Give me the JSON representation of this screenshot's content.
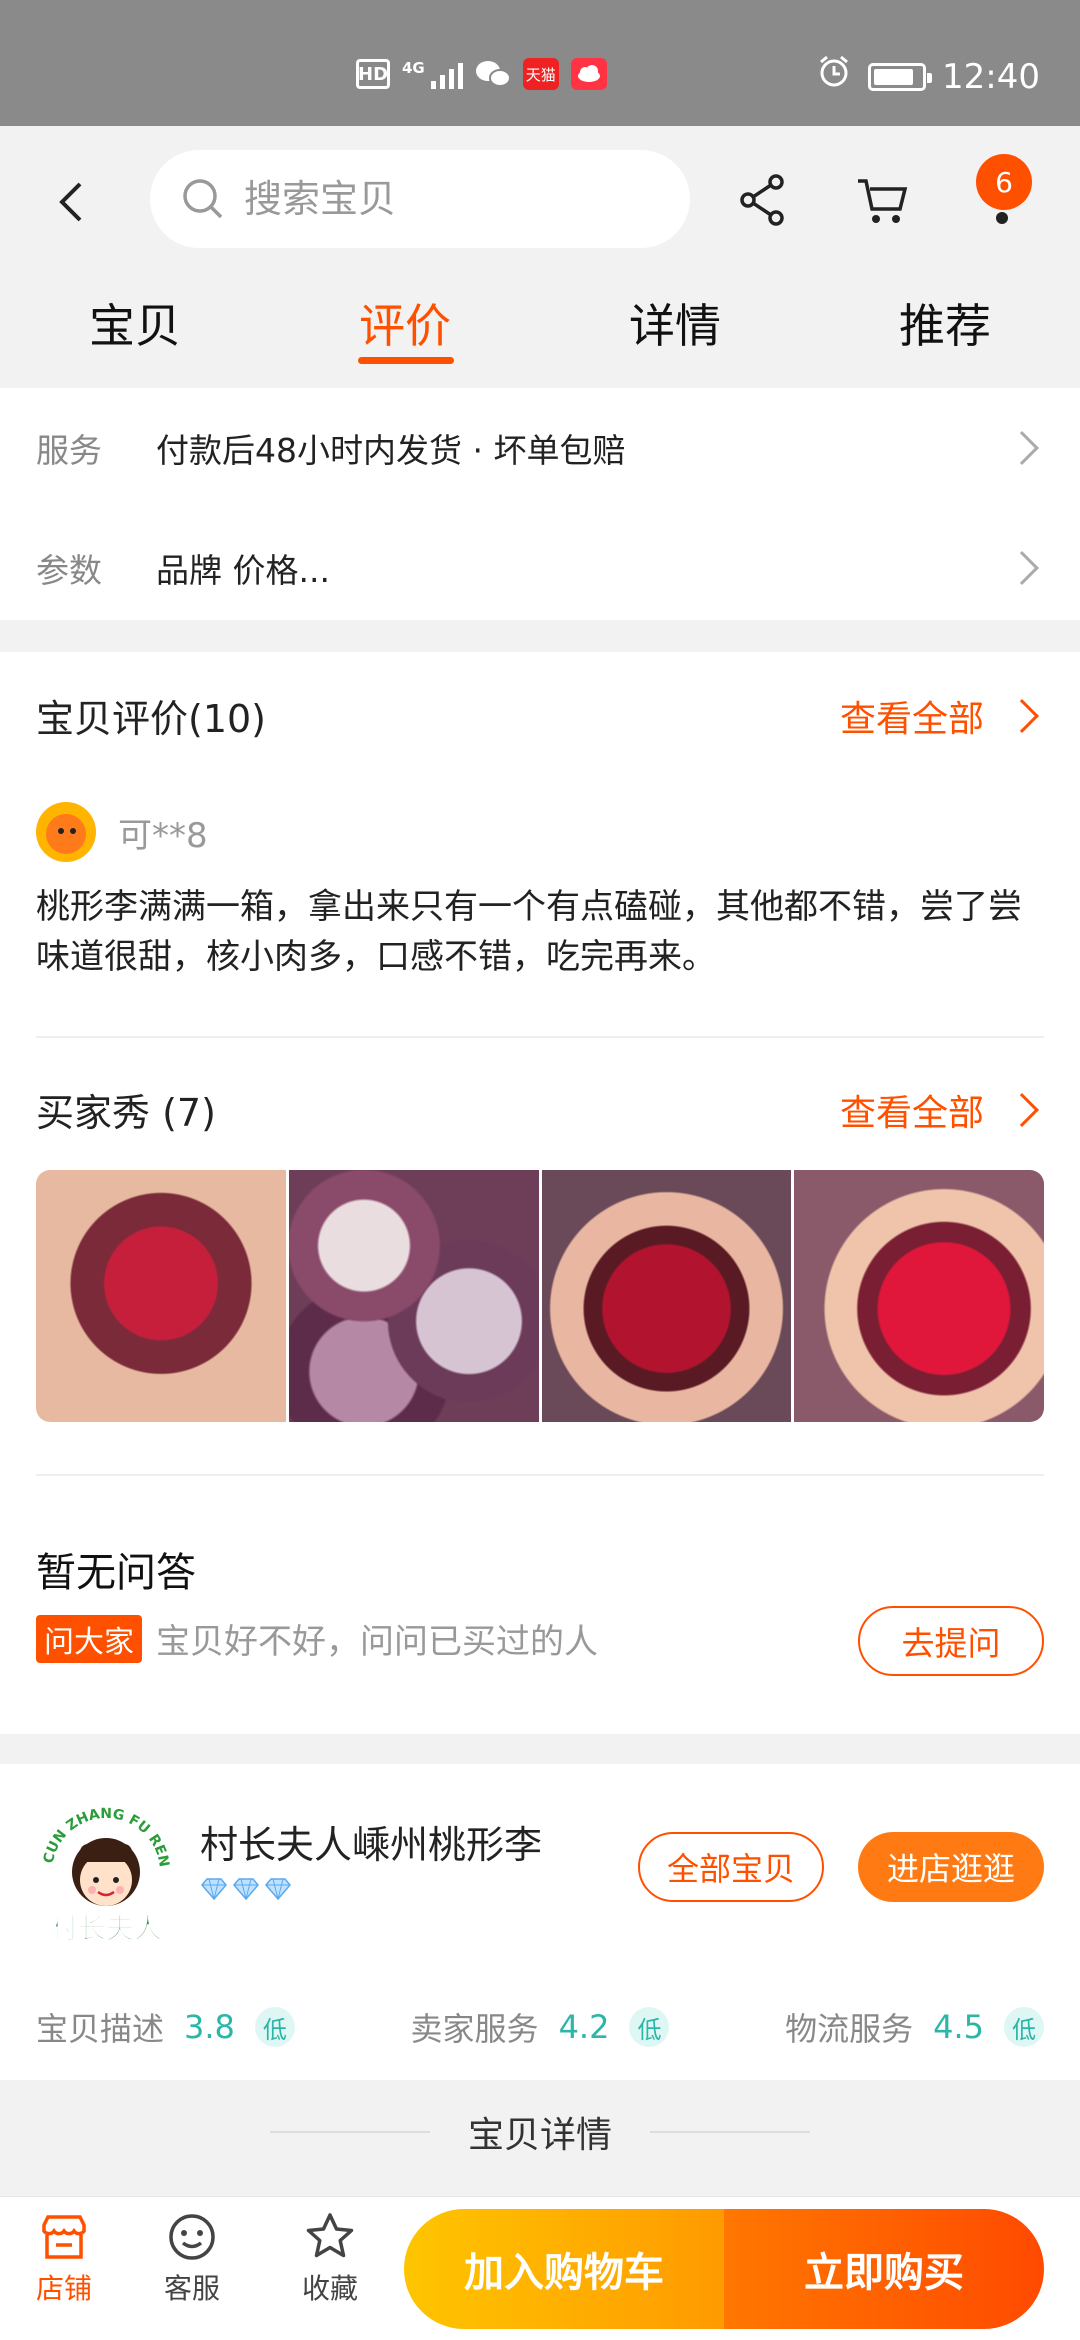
{
  "status_bar": {
    "hd": "HD",
    "network": "4G",
    "tmall_label": "天猫",
    "time": "12:40",
    "battery_level": 0.85
  },
  "header": {
    "search": {
      "placeholder": "搜索宝贝"
    },
    "cart_badge": "6",
    "tabs": [
      {
        "label": "宝贝"
      },
      {
        "label": "评价",
        "active": true
      },
      {
        "label": "详情"
      },
      {
        "label": "推荐"
      }
    ]
  },
  "service": {
    "rows": [
      {
        "key": "服务",
        "value": "付款后48小时内发货 · 坏单包赔"
      },
      {
        "key": "参数",
        "value": "品牌 价格..."
      }
    ]
  },
  "reviews": {
    "title": "宝贝评价(10)",
    "view_all": "查看全部",
    "reviewer": "可**8",
    "text": "桃形李满满一箱，拿出来只有一个有点磕碰，其他都不错，尝了尝味道很甜，核小肉多，口感不错，吃完再来。",
    "buyer_show_title": "买家秀 (7)",
    "buyer_show_view_all": "查看全部"
  },
  "qa": {
    "title": "暂无问答",
    "tag": "问大家",
    "hint": "宝贝好不好，问问已买过的人",
    "ask_button": "去提问"
  },
  "shop": {
    "name": "村长夫人嵊州桃形李",
    "logo_text": "村长夫人",
    "logo_arc": "CUN ZHANG FU REN",
    "diamond_count": 3,
    "all_items_button": "全部宝贝",
    "enter_shop_button": "进店逛逛",
    "ratings": [
      {
        "key": "宝贝描述",
        "value": "3.8",
        "tag": "低"
      },
      {
        "key": "卖家服务",
        "value": "4.2",
        "tag": "低"
      },
      {
        "key": "物流服务",
        "value": "4.5",
        "tag": "低"
      }
    ]
  },
  "detail_title": "宝贝详情",
  "bottom_bar": {
    "shop_label": "店铺",
    "service_label": "客服",
    "favorite_label": "收藏",
    "add_to_cart": "加入购物车",
    "buy_now": "立即购买"
  },
  "colors": {
    "accent": "#ff5000",
    "rating": "#2cb6a8"
  }
}
